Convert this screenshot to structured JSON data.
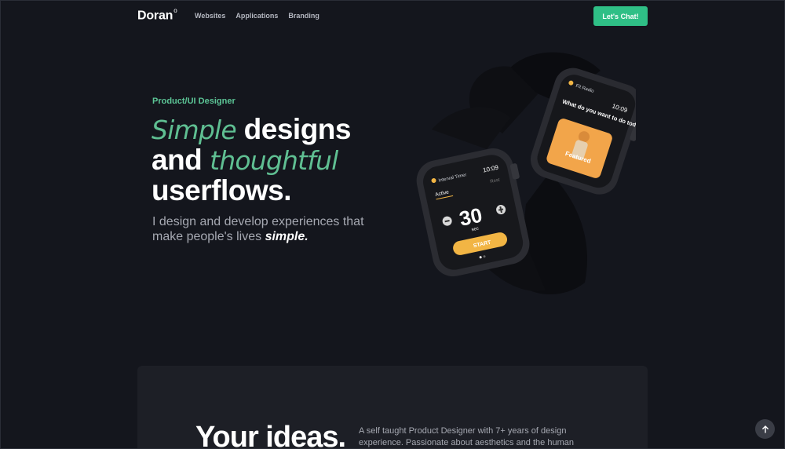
{
  "nav": {
    "logo": "Doran",
    "logo_mark": "o",
    "links": [
      "Websites",
      "Applications",
      "Branding"
    ],
    "cta": "Let's Chat!"
  },
  "hero": {
    "eyebrow": "Product/UI Designer",
    "h_simple": "Simple",
    "h_designs": "designs",
    "h_and": "and",
    "h_thoughtful": "thoughtful",
    "h_userflows": "userflows.",
    "sub_text": "I design and develop experiences that make people's lives ",
    "sub_em": "simple."
  },
  "watch_back": {
    "app": "Fit Radio",
    "time": "10:09",
    "question": "What do you want to do today?",
    "card_label": "Featured"
  },
  "watch_front": {
    "app": "Interval Timer",
    "time": "10:09",
    "tab_active": "Active",
    "tab_rest": "Rest",
    "value": "30",
    "unit": "sec",
    "button": "START"
  },
  "section2": {
    "heading": "Your ideas.",
    "bio": "A self taught Product Designer with 7+ years of design experience. Passionate about aesthetics and the human"
  },
  "colors": {
    "background": "#14161d",
    "accent": "#2fbf86",
    "card": "#1d1f26",
    "watch_accent": "#f2b544"
  }
}
